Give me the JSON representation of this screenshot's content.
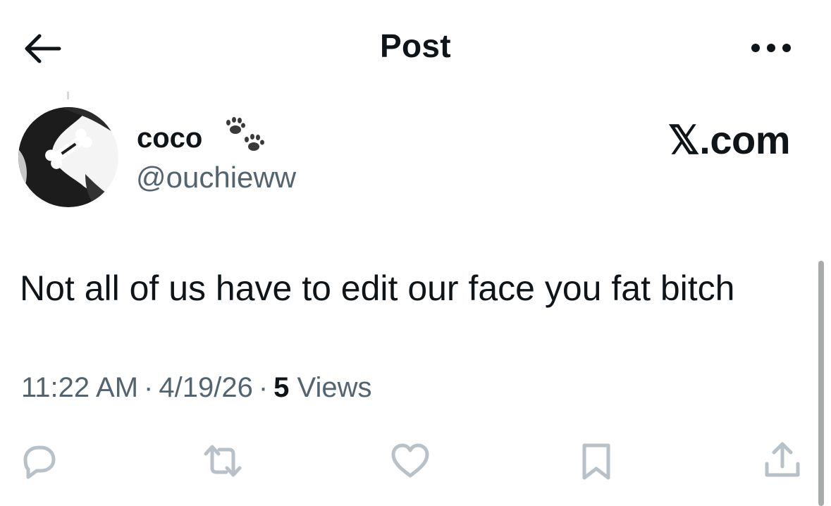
{
  "header": {
    "title": "Post",
    "back_icon": "arrow-left-icon",
    "more_icon": "more-horizontal-icon"
  },
  "author": {
    "display_name": "coco",
    "handle": "@ouchieww",
    "name_emoji_icon": "paw-prints-icon"
  },
  "brand": "𝕏.com",
  "post": {
    "text": "Not all of us have to edit our face you fat bitch"
  },
  "meta": {
    "time": "11:22 AM",
    "separator": "·",
    "date": "4/19/26",
    "views_count": "5",
    "views_label": "Views"
  },
  "actions": [
    {
      "icon": "reply-icon"
    },
    {
      "icon": "repost-icon"
    },
    {
      "icon": "like-icon"
    },
    {
      "icon": "bookmark-icon"
    },
    {
      "icon": "share-icon"
    }
  ],
  "colors": {
    "text": "#0f1419",
    "secondary": "#536471",
    "action_icons": "#b9c1c8"
  }
}
